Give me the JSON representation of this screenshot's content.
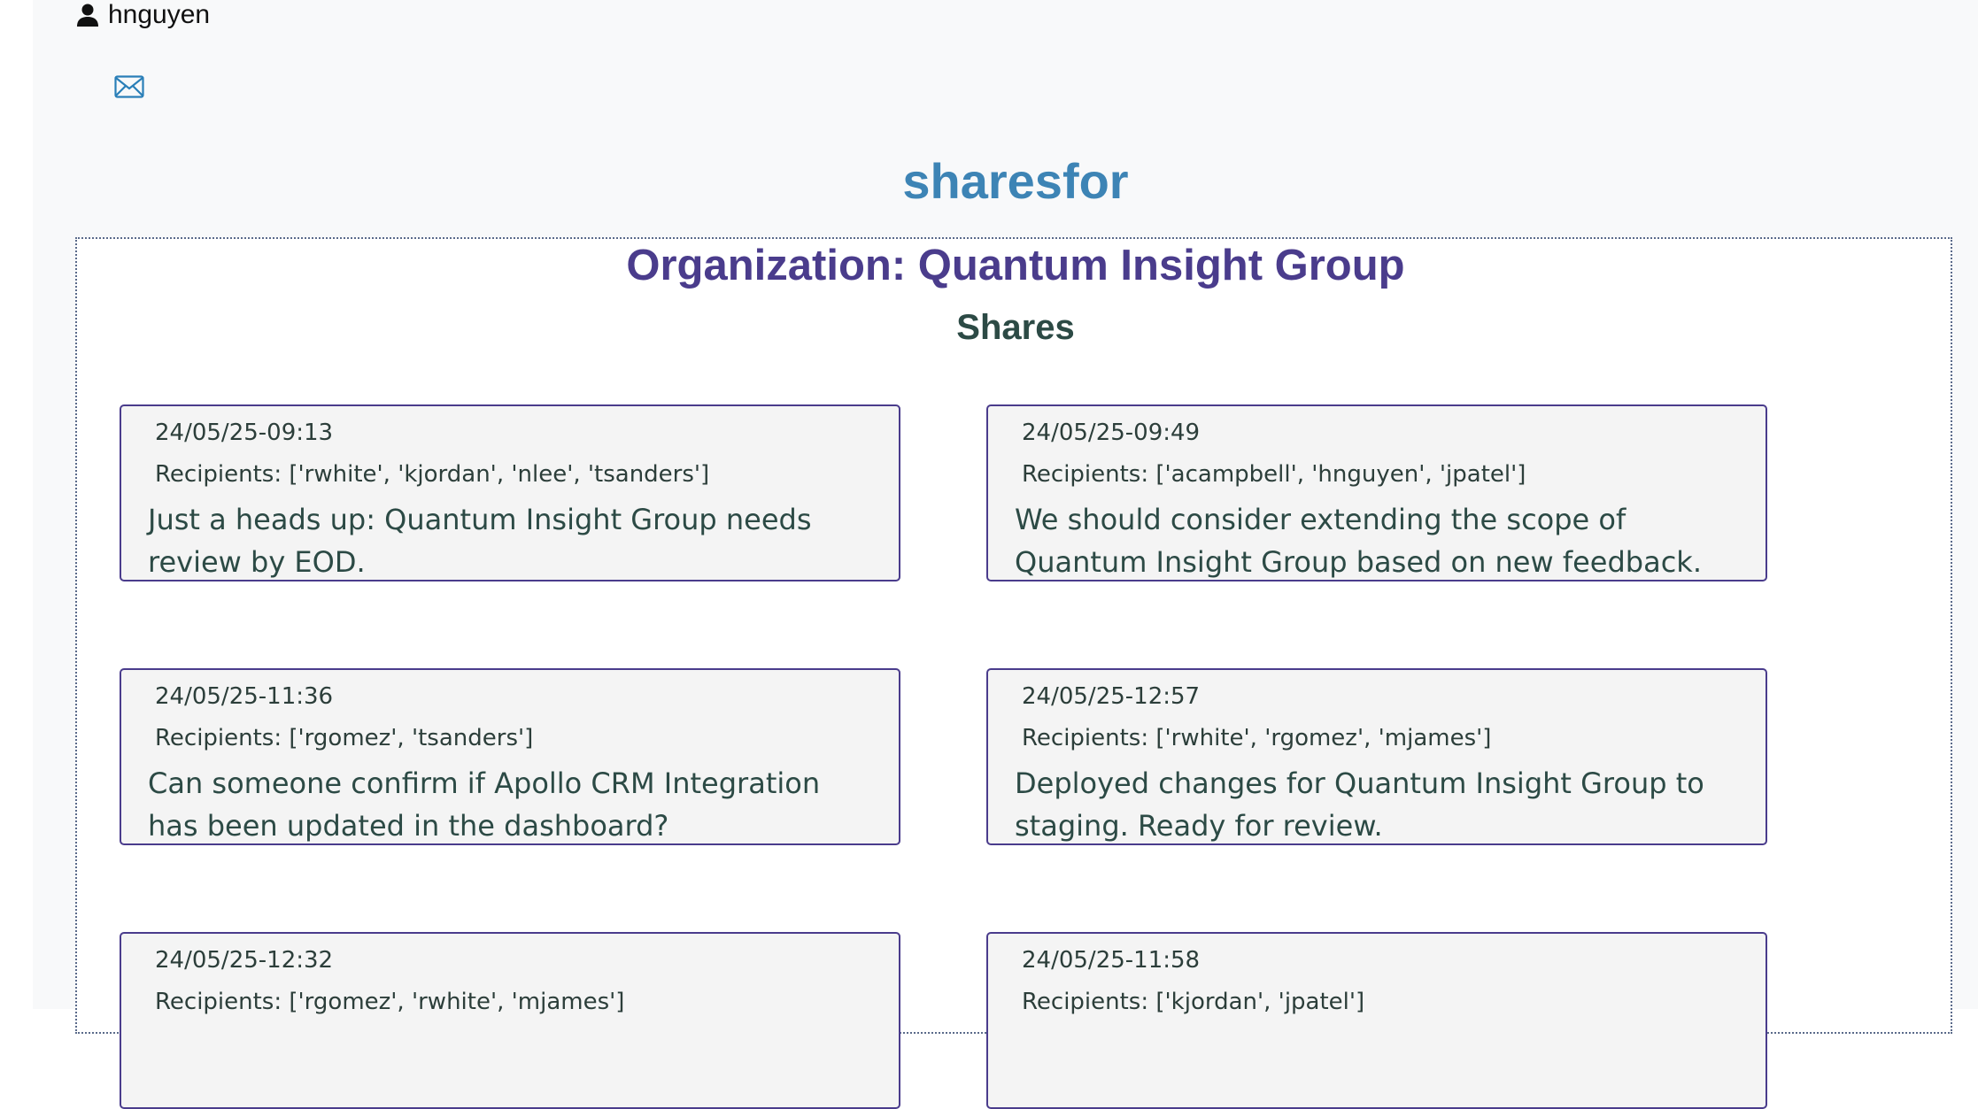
{
  "user": {
    "username": "hnguyen",
    "icon": "person-icon"
  },
  "mail": {
    "icon": "envelope-icon"
  },
  "app_title": "sharesfor",
  "organization_title": "Organization: Quantum Insight Group",
  "shares_heading": "Shares",
  "colors": {
    "app_title": "#3d84b5",
    "org_title": "#4a3c8c",
    "card_border": "#4a3c8c",
    "text": "#2c4a45"
  },
  "shares": [
    {
      "time": "24/05/25-09:13",
      "recipients": "Recipients: ['rwhite', 'kjordan', 'nlee', 'tsanders']",
      "message": "Just a heads up: Quantum Insight Group needs review by EOD."
    },
    {
      "time": "24/05/25-09:49",
      "recipients": "Recipients: ['acampbell', 'hnguyen', 'jpatel']",
      "message": "We should consider extending the scope of Quantum Insight Group based on new feedback."
    },
    {
      "time": "24/05/25-11:36",
      "recipients": "Recipients: ['rgomez', 'tsanders']",
      "message": "Can someone confirm if Apollo CRM Integration has been updated in the dashboard?"
    },
    {
      "time": "24/05/25-12:57",
      "recipients": "Recipients: ['rwhite', 'rgomez', 'mjames']",
      "message": "Deployed changes for Quantum Insight Group to staging. Ready for review."
    },
    {
      "time": "24/05/25-12:32",
      "recipients": "Recipients: ['rgomez', 'rwhite', 'mjames']",
      "message": ""
    },
    {
      "time": "24/05/25-11:58",
      "recipients": "Recipients: ['kjordan', 'jpatel']",
      "message": ""
    }
  ]
}
